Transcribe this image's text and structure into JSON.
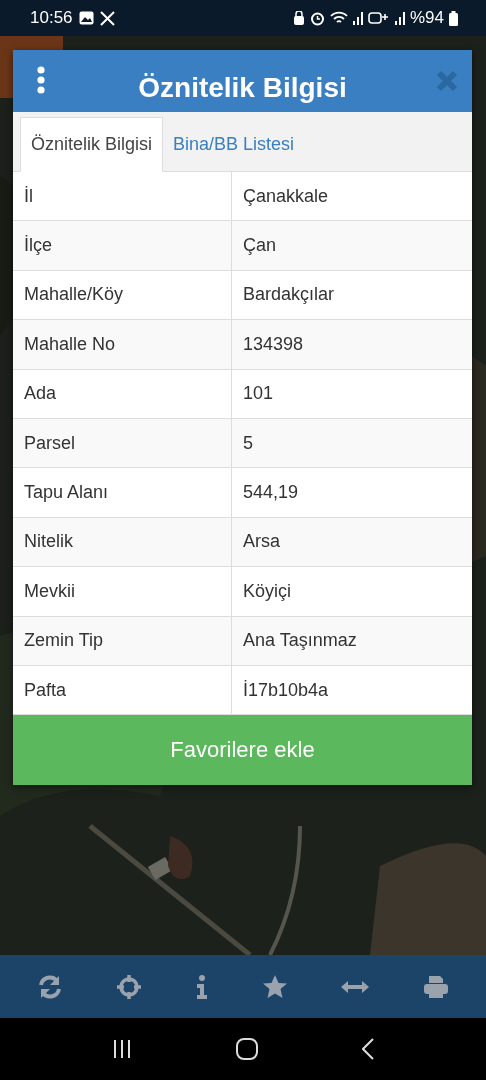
{
  "status_bar": {
    "time": "10:56",
    "battery": "%94"
  },
  "dialog": {
    "title": "Öznitelik Bilgisi",
    "tabs": [
      {
        "label": "Öznitelik Bilgisi",
        "selected": true
      },
      {
        "label": "Bina/BB Listesi",
        "selected": false
      }
    ],
    "rows": [
      {
        "label": "İl",
        "value": "Çanakkale"
      },
      {
        "label": "İlçe",
        "value": "Çan"
      },
      {
        "label": "Mahalle/Köy",
        "value": "Bardakçılar"
      },
      {
        "label": "Mahalle No",
        "value": "134398"
      },
      {
        "label": "Ada",
        "value": "101"
      },
      {
        "label": "Parsel",
        "value": "5"
      },
      {
        "label": "Tapu Alanı",
        "value": "544,19"
      },
      {
        "label": "Nitelik",
        "value": "Arsa"
      },
      {
        "label": "Mevkii",
        "value": "Köyiçi"
      },
      {
        "label": "Zemin Tip",
        "value": "Ana Taşınmaz"
      },
      {
        "label": "Pafta",
        "value": "İ17b10b4a"
      }
    ],
    "button": "Favorilere ekle"
  }
}
